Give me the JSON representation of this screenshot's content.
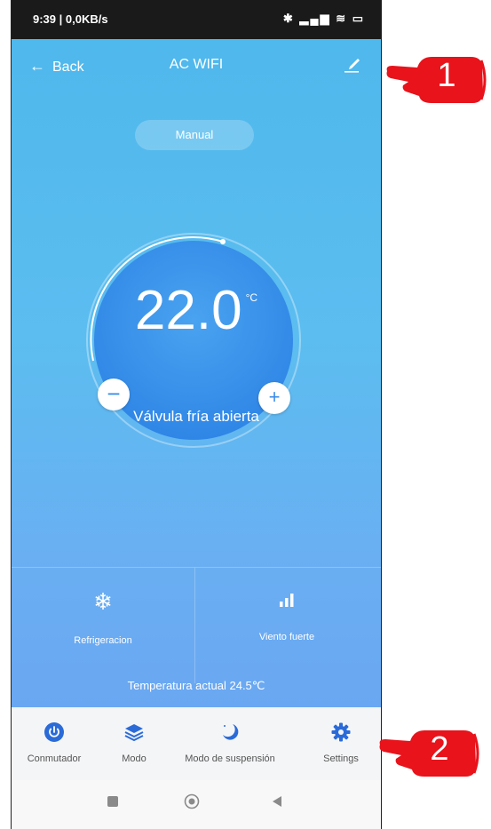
{
  "status_bar": {
    "time": "9:39 | 0,0KB/s",
    "icons": "✱ ▂▄▆ ≋ ▭"
  },
  "header": {
    "back_label": "Back",
    "title": "AC WIFI"
  },
  "mode_pill": "Manual",
  "thermostat": {
    "temperature": "22.0",
    "unit": "°C",
    "status": "Válvula fría abierta"
  },
  "modes": {
    "left": {
      "label": "Refrigeracion",
      "icon": "snowflake-icon"
    },
    "right": {
      "label": "Viento fuerte",
      "icon": "signal-bars-icon"
    }
  },
  "current_temp": "Temperatura actual  24.5℃",
  "tabs": [
    {
      "label": "Conmutador",
      "icon": "power-icon"
    },
    {
      "label": "Modo",
      "icon": "layers-icon"
    },
    {
      "label": "Modo de suspensión",
      "icon": "moon-icon"
    },
    {
      "label": "Settings",
      "icon": "gear-icon"
    }
  ],
  "callouts": [
    "1",
    "2"
  ],
  "colors": {
    "accent": "#2a6bd8",
    "callout": "#e8131b",
    "background_top": "#4fb8ec",
    "background_bottom": "#6aa7f2"
  }
}
